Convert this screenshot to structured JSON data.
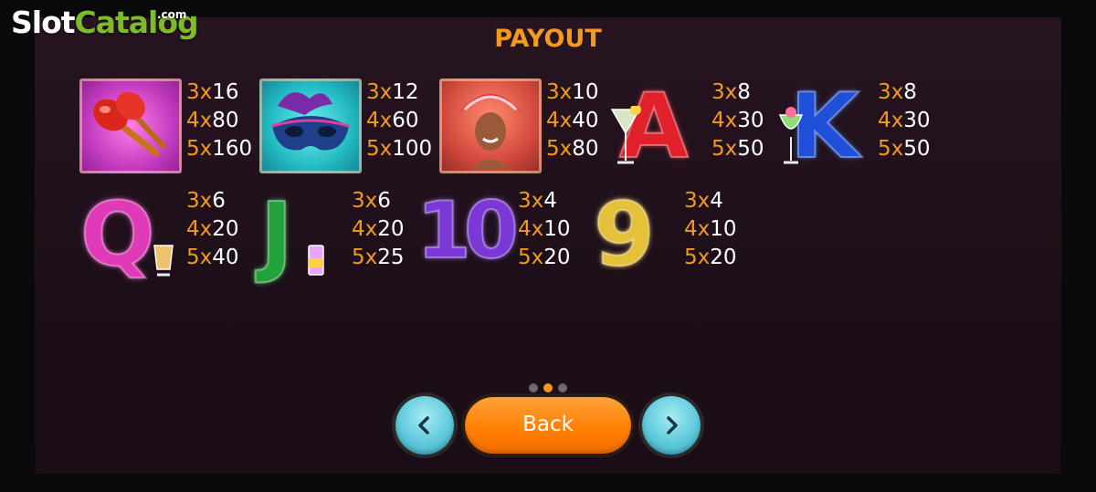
{
  "watermark": {
    "slot": "Slot",
    "catalog": "Catalog",
    "com": ".com"
  },
  "title": "PAYOUT",
  "symbols": [
    {
      "icon": "maracas-icon",
      "lines": [
        {
          "c": "3x",
          "v": "16"
        },
        {
          "c": "4x",
          "v": "80"
        },
        {
          "c": "5x",
          "v": "160"
        }
      ]
    },
    {
      "icon": "carnival-mask-icon",
      "lines": [
        {
          "c": "3x",
          "v": "12"
        },
        {
          "c": "4x",
          "v": "60"
        },
        {
          "c": "5x",
          "v": "100"
        }
      ]
    },
    {
      "icon": "carnival-dancer-icon",
      "lines": [
        {
          "c": "3x",
          "v": "10"
        },
        {
          "c": "4x",
          "v": "40"
        },
        {
          "c": "5x",
          "v": "80"
        }
      ]
    },
    {
      "icon": "letter-a-icon",
      "letter": "A",
      "lines": [
        {
          "c": "3x",
          "v": "8"
        },
        {
          "c": "4x",
          "v": "30"
        },
        {
          "c": "5x",
          "v": "50"
        }
      ]
    },
    {
      "icon": "letter-k-icon",
      "letter": "K",
      "lines": [
        {
          "c": "3x",
          "v": "8"
        },
        {
          "c": "4x",
          "v": "30"
        },
        {
          "c": "5x",
          "v": "50"
        }
      ]
    },
    {
      "icon": "letter-q-icon",
      "letter": "Q",
      "lines": [
        {
          "c": "3x",
          "v": "6"
        },
        {
          "c": "4x",
          "v": "20"
        },
        {
          "c": "5x",
          "v": "40"
        }
      ]
    },
    {
      "icon": "letter-j-icon",
      "letter": "J",
      "lines": [
        {
          "c": "3x",
          "v": "6"
        },
        {
          "c": "4x",
          "v": "20"
        },
        {
          "c": "5x",
          "v": "25"
        }
      ]
    },
    {
      "icon": "number-10-icon",
      "letter": "10",
      "lines": [
        {
          "c": "3x",
          "v": "4"
        },
        {
          "c": "4x",
          "v": "10"
        },
        {
          "c": "5x",
          "v": "20"
        }
      ]
    },
    {
      "icon": "number-9-icon",
      "letter": "9",
      "lines": [
        {
          "c": "3x",
          "v": "4"
        },
        {
          "c": "4x",
          "v": "10"
        },
        {
          "c": "5x",
          "v": "20"
        }
      ]
    }
  ],
  "pagination": {
    "pages": 3,
    "current": 2
  },
  "buttons": {
    "back_label": "Back",
    "prev_icon": "chevron-left-icon",
    "next_icon": "chevron-right-icon"
  },
  "colors": {
    "accent": "#f39a1e",
    "button_orange": "#ff7e00",
    "nav_cyan": "#5fc9dc",
    "background": "#1d0f19"
  }
}
